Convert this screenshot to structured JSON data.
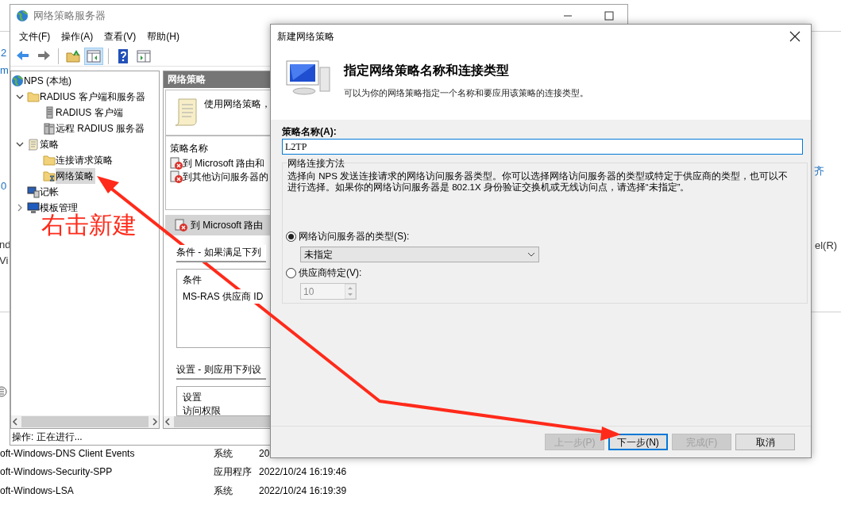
{
  "desktop": {
    "edge_texts": [
      "2",
      "m",
      "0",
      "nd",
      "Vi",
      "齐",
      "el(R)"
    ]
  },
  "event_rows": [
    {
      "source": "oft-Windows-DNS Client Events",
      "type": "系统",
      "time": "20"
    },
    {
      "source": "oft-Windows-Security-SPP",
      "type": "应用程序",
      "time": "2022/10/24 16:19:46"
    },
    {
      "source": "oft-Windows-LSA",
      "type": "系统",
      "time": "2022/10/24 16:19:39"
    }
  ],
  "mmc": {
    "title": "网络策略服务器",
    "menu": [
      "文件(F)",
      "操作(A)",
      "查看(V)",
      "帮助(H)"
    ],
    "toolbar_groups": [
      [
        {
          "kind": "back",
          "pressed": false
        },
        {
          "kind": "forward",
          "pressed": false
        }
      ],
      [
        {
          "kind": "up",
          "pressed": false
        },
        {
          "kind": "tree",
          "pressed": true
        }
      ],
      [
        {
          "kind": "help",
          "pressed": false
        },
        {
          "kind": "panel",
          "pressed": false
        }
      ]
    ],
    "tree": [
      {
        "label": "NPS (本地)",
        "kind": "globe",
        "selected": false,
        "children": [
          {
            "label": "RADIUS 客户端和服务器",
            "kind": "folder",
            "expanded": true,
            "selected": false,
            "children": [
              {
                "label": "RADIUS 客户端",
                "kind": "server",
                "selected": false
              },
              {
                "label": "远程 RADIUS 服务器",
                "kind": "servers",
                "selected": false
              }
            ]
          },
          {
            "label": "策略",
            "kind": "scroll",
            "expanded": true,
            "selected": false,
            "children": [
              {
                "label": "连接请求策略",
                "kind": "folder",
                "selected": false
              },
              {
                "label": "网络策略",
                "kind": "policy",
                "selected": true
              }
            ]
          },
          {
            "label": "记帐",
            "kind": "computer",
            "selected": false
          },
          {
            "label": "模板管理",
            "kind": "monitor",
            "expanded": false,
            "selected": false
          }
        ]
      }
    ],
    "pane": {
      "header": "网络策略",
      "intro": "使用网络策略，",
      "list_header": "策略名称",
      "policies": [
        "到 Microsoft 路由和",
        "到其他访问服务器的"
      ],
      "detail_title": "到 Microsoft 路由",
      "conditions_heading": "条件 - 如果满足下列",
      "conditions_column": "条件",
      "conditions_rows": [
        "MS-RAS 供应商 ID"
      ],
      "settings_heading": "设置 - 则应用下列设",
      "settings_column": "设置",
      "settings_rows": [
        "访问权限"
      ]
    },
    "status": "操作: 正在进行..."
  },
  "annotation": {
    "text": "右击新建"
  },
  "dialog": {
    "title": "新建网络策略",
    "heading": "指定网络策略名称和连接类型",
    "subheading": "可以为你的网络策略指定一个名称和要应用该策略的连接类型。",
    "name_label": "策略名称(A):",
    "name_value": "L2TP",
    "group_title": "网络连接方法",
    "group_text": "选择向 NPS 发送连接请求的网络访问服务器类型。你可以选择网络访问服务器的类型或特定于供应商的类型，也可以不进行选择。如果你的网络访问服务器是 802.1X 身份验证交换机或无线访问点，请选择“未指定”。",
    "options": [
      {
        "label": "网络访问服务器的类型(S):",
        "selected": true,
        "kind": "dropdown",
        "value": "未指定",
        "disabled": false
      },
      {
        "label": "供应商特定(V):",
        "selected": false,
        "kind": "spinner",
        "value": "10",
        "disabled": true
      }
    ],
    "buttons": [
      {
        "label": "上一步(P)",
        "disabled": true,
        "default": false
      },
      {
        "label": "下一步(N)",
        "disabled": false,
        "default": true
      },
      {
        "label": "完成(F)",
        "disabled": true,
        "default": false
      },
      {
        "label": "取消",
        "disabled": false,
        "default": false
      }
    ]
  }
}
